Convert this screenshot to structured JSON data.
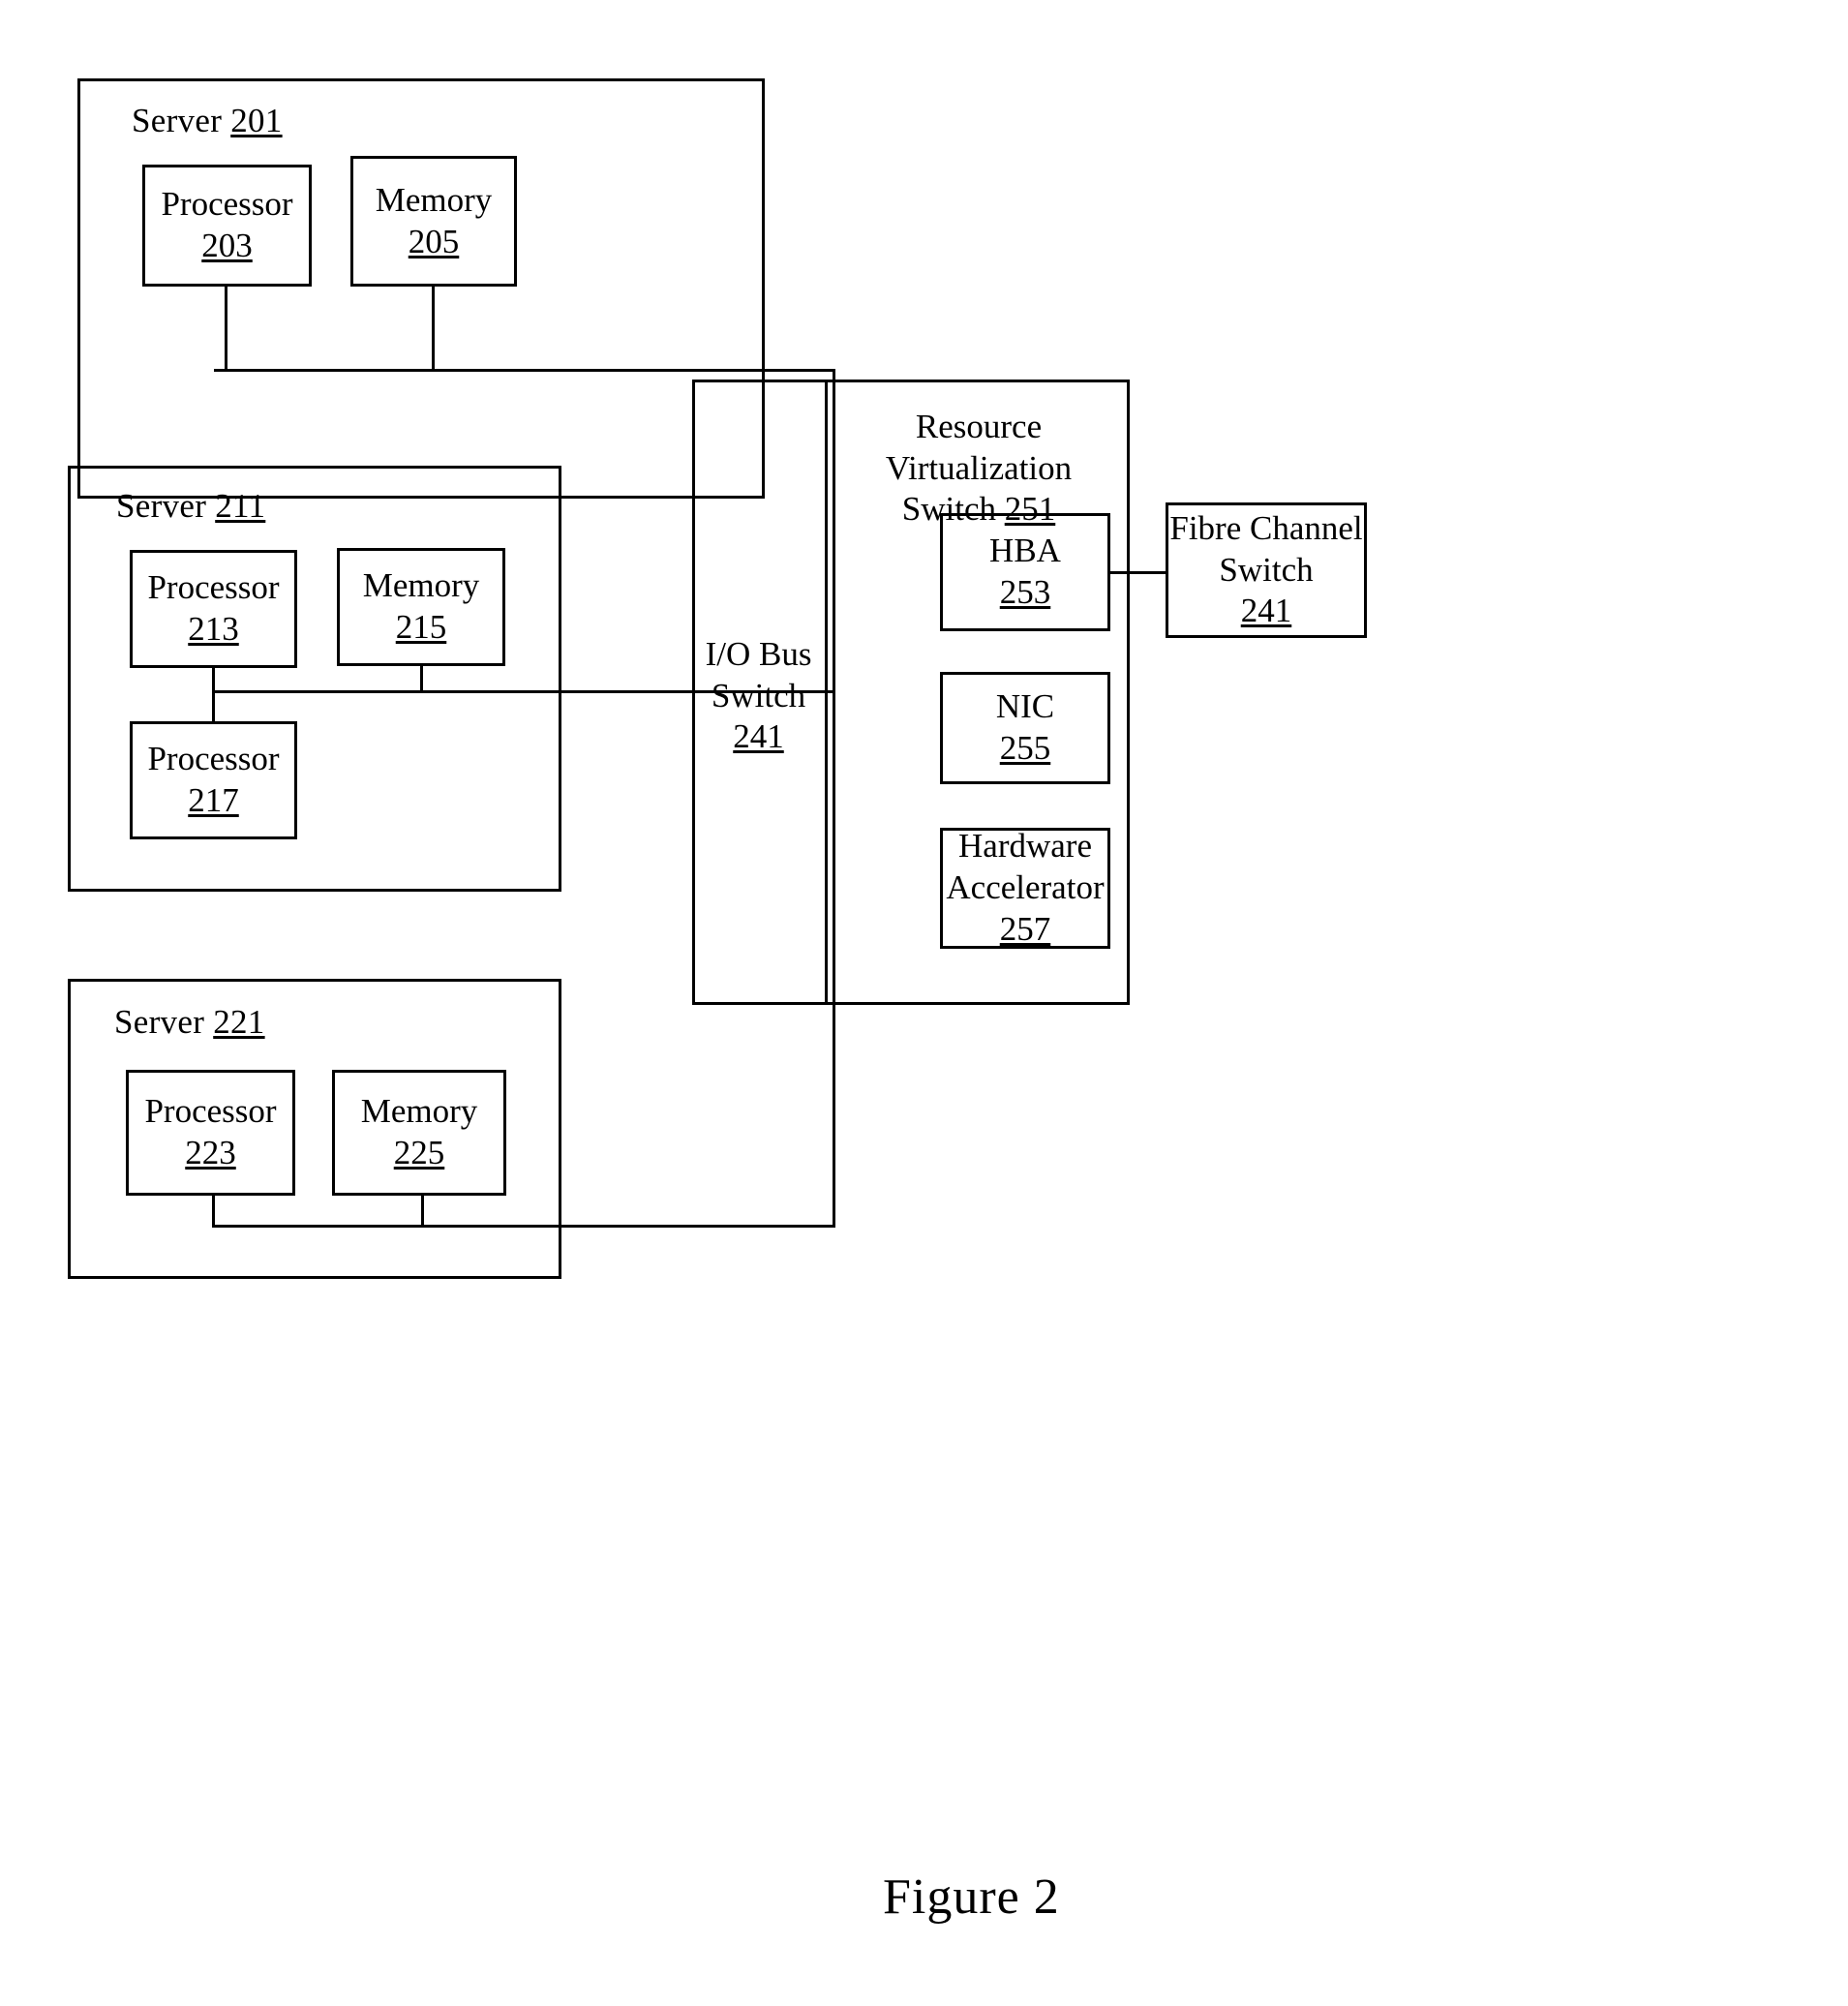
{
  "figure": {
    "caption": "Figure 2"
  },
  "servers": [
    {
      "id": "server-201",
      "label": "Server",
      "ref": "201",
      "components": [
        {
          "id": "processor-203",
          "name": "Processor",
          "ref": "203"
        },
        {
          "id": "memory-205",
          "name": "Memory",
          "ref": "205"
        }
      ]
    },
    {
      "id": "server-211",
      "label": "Server",
      "ref": "211",
      "components": [
        {
          "id": "processor-213",
          "name": "Processor",
          "ref": "213"
        },
        {
          "id": "memory-215",
          "name": "Memory",
          "ref": "215"
        },
        {
          "id": "processor-217",
          "name": "Processor",
          "ref": "217"
        }
      ]
    },
    {
      "id": "server-221",
      "label": "Server",
      "ref": "221",
      "components": [
        {
          "id": "processor-223",
          "name": "Processor",
          "ref": "223"
        },
        {
          "id": "memory-225",
          "name": "Memory",
          "ref": "225"
        }
      ]
    }
  ],
  "io_bus_switch": {
    "line1": "I/O Bus",
    "line2": "Switch",
    "ref": "241"
  },
  "resource_virtualization_switch": {
    "line1": "Resource Virtualization",
    "line2": "Switch",
    "ref": "251",
    "adapters": [
      {
        "id": "hba-253",
        "line1": "HBA",
        "line2": "",
        "ref": "253"
      },
      {
        "id": "nic-255",
        "line1": "NIC",
        "line2": "",
        "ref": "255"
      },
      {
        "id": "hardware-accelerator-257",
        "line1": "Hardware",
        "line2": "Accelerator",
        "ref": "257"
      }
    ]
  },
  "fibre_channel_switch": {
    "line1": "Fibre Channel",
    "line2": "Switch",
    "ref": "241"
  },
  "colors": {
    "ink": "#000000",
    "background": "#ffffff"
  }
}
